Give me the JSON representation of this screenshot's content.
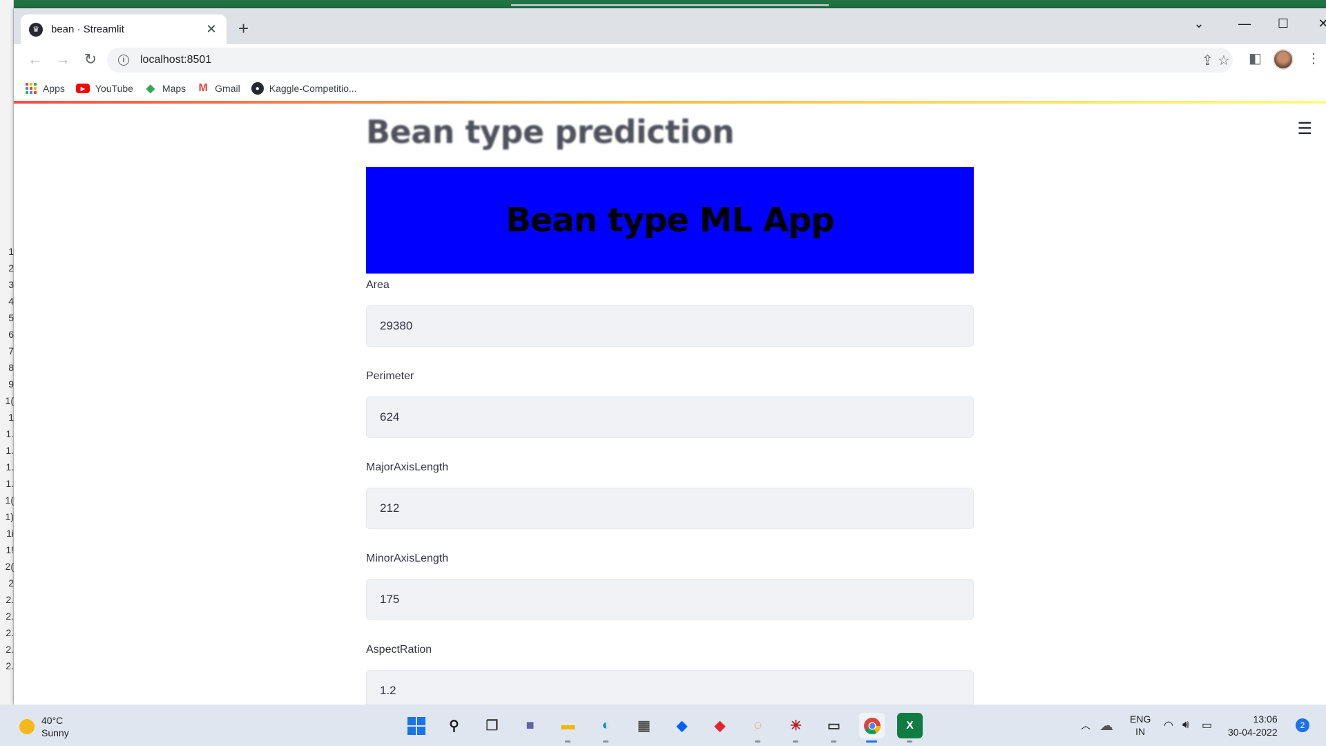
{
  "browser": {
    "tab_title": "bean · Streamlit",
    "url": "localhost:8501",
    "bookmarks": [
      {
        "label": "Apps",
        "icon": "apps-grid-icon"
      },
      {
        "label": "YouTube",
        "icon": "youtube-icon"
      },
      {
        "label": "Maps",
        "icon": "maps-icon"
      },
      {
        "label": "Gmail",
        "icon": "gmail-icon"
      },
      {
        "label": "Kaggle-Competitio...",
        "icon": "github-icon"
      }
    ]
  },
  "app": {
    "title": "Bean type prediction",
    "banner": "Bean type ML App",
    "banner_color": "#0000ff",
    "fields": [
      {
        "label": "Area",
        "value": "29380"
      },
      {
        "label": "Perimeter",
        "value": "624"
      },
      {
        "label": "MajorAxisLength",
        "value": "212"
      },
      {
        "label": "MinorAxisLength",
        "value": "175"
      },
      {
        "label": "AspectRation",
        "value": "1.2"
      }
    ]
  },
  "taskbar": {
    "weather_temp": "40°C",
    "weather_desc": "Sunny",
    "lang_1": "ENG",
    "lang_2": "IN",
    "time": "13:06",
    "date": "30-04-2022",
    "notification_count": "2"
  },
  "background_excel_rows": [
    "1",
    "2",
    "3",
    "4",
    "5",
    "6",
    "7",
    "8",
    "9",
    "1(",
    "1",
    "1.",
    "1.",
    "1.",
    "1.",
    "1(",
    "1)",
    "1i",
    "1!",
    "2(",
    "2",
    "2.",
    "2.",
    "2.",
    "2.",
    "2."
  ]
}
